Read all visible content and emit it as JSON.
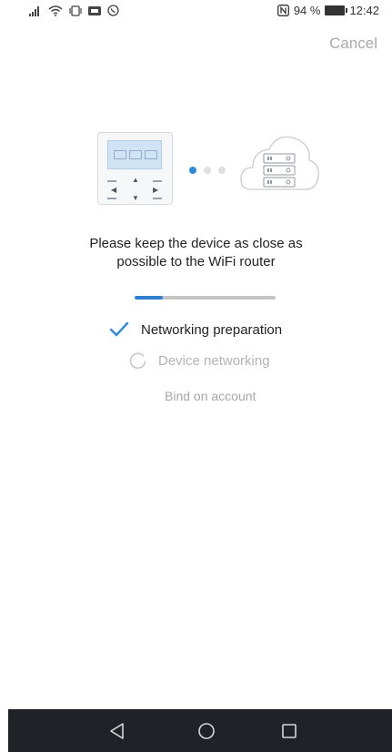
{
  "status_bar": {
    "battery_percent": "94 %",
    "time": "12:42",
    "icons": [
      "signal-icon",
      "wifi-icon",
      "vibrate-icon",
      "message-icon",
      "whatsapp-icon",
      "nfc-icon",
      "battery-icon"
    ]
  },
  "header": {
    "cancel_label": "Cancel"
  },
  "pairing": {
    "active_dot": 0,
    "dot_count": 3
  },
  "message": {
    "line1": "Please keep the device as close as",
    "line2": "possible to the WiFi router"
  },
  "progress": {
    "value_percent": 20
  },
  "steps": [
    {
      "label": "Networking preparation",
      "status": "done"
    },
    {
      "label": "Device networking",
      "status": "in-progress"
    },
    {
      "label": "Bind on account",
      "status": "pending"
    }
  ],
  "colors": {
    "accent": "#2d8cdc",
    "progress_fill": "#2d7fd3",
    "progress_track": "#c4c4c4",
    "inactive_text": "#b3b3b3",
    "cancel_text": "#a9a9a9",
    "nav_bar": "#1f2327"
  },
  "nav": {
    "items": [
      "back-icon",
      "home-icon",
      "recents-icon"
    ]
  }
}
